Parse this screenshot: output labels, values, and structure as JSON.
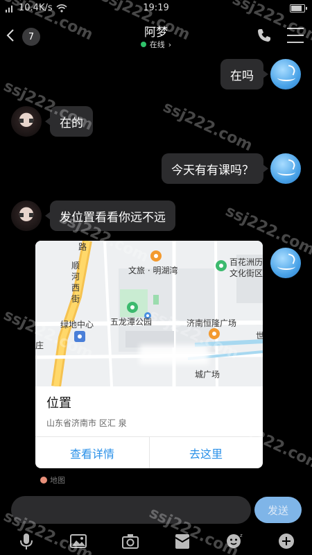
{
  "status_bar": {
    "network_speed": "10.4K/s",
    "time": "19:19",
    "battery_level": 0.9
  },
  "header": {
    "unread_count": "7",
    "contact_name": "阿梦",
    "online_status": "在线",
    "online_chevron": "›"
  },
  "messages": [
    {
      "side": "right",
      "text": "在吗"
    },
    {
      "side": "left",
      "text": "在的"
    },
    {
      "side": "right",
      "text": "今天有有课吗？"
    },
    {
      "side": "left",
      "text": "发位置看看你远不远"
    }
  ],
  "location_card": {
    "map_labels": {
      "street_a": "顺河西街",
      "poi_wenlv": "文旅 · 明湖湾",
      "poi_baihuazhou_1": "百花洲历",
      "poi_baihuazhou_2": "文化街区",
      "poi_park": "五龙潭公园",
      "poi_lvdi": "绿地中心",
      "poi_hengl": "济南恒隆广场",
      "poi_zhuang": "庄",
      "poi_guangchang": "城广场",
      "road_lu": "路",
      "edge_shi": "世"
    },
    "title": "位置",
    "address": "山东省济南市 区汇 泉",
    "view_details_label": "查看详情",
    "go_here_label": "去这里"
  },
  "partial_text": "地图",
  "input": {
    "placeholder": "",
    "send_label": "发送"
  },
  "toolbar_icons": [
    "microphone-icon",
    "image-icon",
    "camera-icon",
    "gift-icon",
    "emoji-icon",
    "plus-icon"
  ],
  "watermark_text": "ssj222.com",
  "colors": {
    "background": "#000000",
    "bubble": "#2c2c2e",
    "online": "#2fc26a",
    "link_blue": "#2a90e8",
    "send_button": "#7fb5e8"
  }
}
